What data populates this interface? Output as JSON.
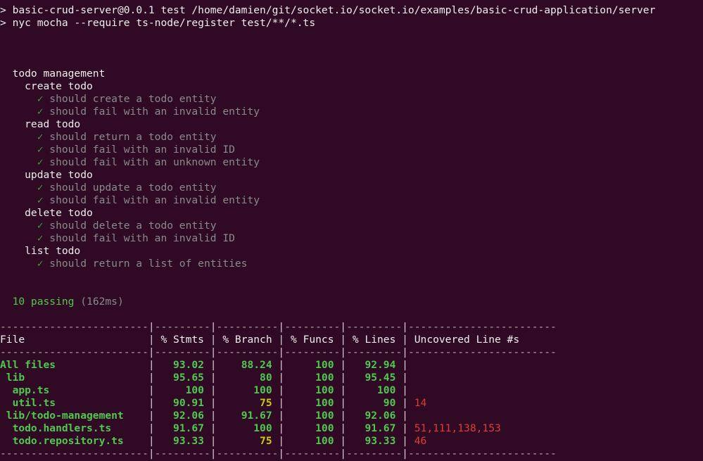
{
  "terminal": {
    "background_color": "#300a24",
    "foreground_color": "#eeeeec",
    "colors": {
      "green": "#4ec94e",
      "dark_green": "#3c9a3c",
      "dim_gray": "#8a8a8a",
      "yellow": "#cdcd00",
      "red": "#e03c35",
      "white": "#eeeeec",
      "rule": "#b9a3ae"
    }
  },
  "npm_header": {
    "prompt": ">",
    "package_line": "basic-crud-server@0.0.1 test /home/damien/git/socket.io/socket.io/examples/basic-crud-application/server",
    "command_line": "nyc mocha --require ts-node/register test/**/*.ts"
  },
  "test_report": {
    "root_suite": "todo management",
    "check_glyph": "✓",
    "suites": [
      {
        "name": "create todo",
        "tests": [
          "should create a todo entity",
          "should fail with an invalid entity"
        ]
      },
      {
        "name": "read todo",
        "tests": [
          "should return a todo entity",
          "should fail with an invalid ID",
          "should fail with an unknown entity"
        ]
      },
      {
        "name": "update todo",
        "tests": [
          "should update a todo entity",
          "should fail with an invalid entity"
        ]
      },
      {
        "name": "delete todo",
        "tests": [
          "should delete a todo entity",
          "should fail with an invalid ID"
        ]
      },
      {
        "name": "list todo",
        "tests": [
          "should return a list of entities"
        ]
      }
    ],
    "summary": {
      "passing_count": "10 passing",
      "duration": "(162ms)"
    }
  },
  "coverage_table": {
    "rule_segments": [
      "------------------------",
      "---------",
      "----------",
      "---------",
      "---------",
      "------------------------"
    ],
    "separator_line": "------------------------|---------|----------|---------|---------|------------------------",
    "columns": [
      {
        "label": "File",
        "width": 24,
        "align": "left"
      },
      {
        "label": "% Stmts",
        "width": 9,
        "align": "right"
      },
      {
        "label": "% Branch",
        "width": 10,
        "align": "right"
      },
      {
        "label": "% Funcs",
        "width": 9,
        "align": "right"
      },
      {
        "label": "% Lines",
        "width": 9,
        "align": "right"
      },
      {
        "label": "Uncovered Line #s",
        "width": 24,
        "align": "left"
      }
    ],
    "rows": [
      {
        "file": "All files",
        "indent": 0,
        "file_color": "green",
        "bold": true,
        "stmts": {
          "value": "93.02",
          "color": "green"
        },
        "branch": {
          "value": "88.24",
          "color": "green"
        },
        "funcs": {
          "value": "100",
          "color": "green"
        },
        "lines": {
          "value": "92.94",
          "color": "green"
        },
        "uncovered": {
          "value": "",
          "color": "red"
        }
      },
      {
        "file": "lib",
        "indent": 1,
        "file_color": "green",
        "bold": true,
        "stmts": {
          "value": "95.65",
          "color": "green"
        },
        "branch": {
          "value": "80",
          "color": "green"
        },
        "funcs": {
          "value": "100",
          "color": "green"
        },
        "lines": {
          "value": "95.45",
          "color": "green"
        },
        "uncovered": {
          "value": "",
          "color": "red"
        }
      },
      {
        "file": "app.ts",
        "indent": 2,
        "file_color": "green",
        "bold": true,
        "stmts": {
          "value": "100",
          "color": "green"
        },
        "branch": {
          "value": "100",
          "color": "green"
        },
        "funcs": {
          "value": "100",
          "color": "green"
        },
        "lines": {
          "value": "100",
          "color": "green"
        },
        "uncovered": {
          "value": "",
          "color": "red"
        }
      },
      {
        "file": "util.ts",
        "indent": 2,
        "file_color": "green",
        "bold": true,
        "stmts": {
          "value": "90.91",
          "color": "green"
        },
        "branch": {
          "value": "75",
          "color": "yellow"
        },
        "funcs": {
          "value": "100",
          "color": "green"
        },
        "lines": {
          "value": "90",
          "color": "green"
        },
        "uncovered": {
          "value": "14",
          "color": "red"
        }
      },
      {
        "file": "lib/todo-management",
        "indent": 1,
        "file_color": "green",
        "bold": true,
        "stmts": {
          "value": "92.06",
          "color": "green"
        },
        "branch": {
          "value": "91.67",
          "color": "green"
        },
        "funcs": {
          "value": "100",
          "color": "green"
        },
        "lines": {
          "value": "92.06",
          "color": "green"
        },
        "uncovered": {
          "value": "",
          "color": "red"
        }
      },
      {
        "file": "todo.handlers.ts",
        "indent": 2,
        "file_color": "green",
        "bold": true,
        "stmts": {
          "value": "91.67",
          "color": "green"
        },
        "branch": {
          "value": "100",
          "color": "green"
        },
        "funcs": {
          "value": "100",
          "color": "green"
        },
        "lines": {
          "value": "91.67",
          "color": "green"
        },
        "uncovered": {
          "value": "51,111,138,153",
          "color": "red"
        }
      },
      {
        "file": "todo.repository.ts",
        "indent": 2,
        "file_color": "green",
        "bold": true,
        "stmts": {
          "value": "93.33",
          "color": "green"
        },
        "branch": {
          "value": "75",
          "color": "yellow"
        },
        "funcs": {
          "value": "100",
          "color": "green"
        },
        "lines": {
          "value": "93.33",
          "color": "green"
        },
        "uncovered": {
          "value": "46",
          "color": "red"
        }
      }
    ]
  }
}
